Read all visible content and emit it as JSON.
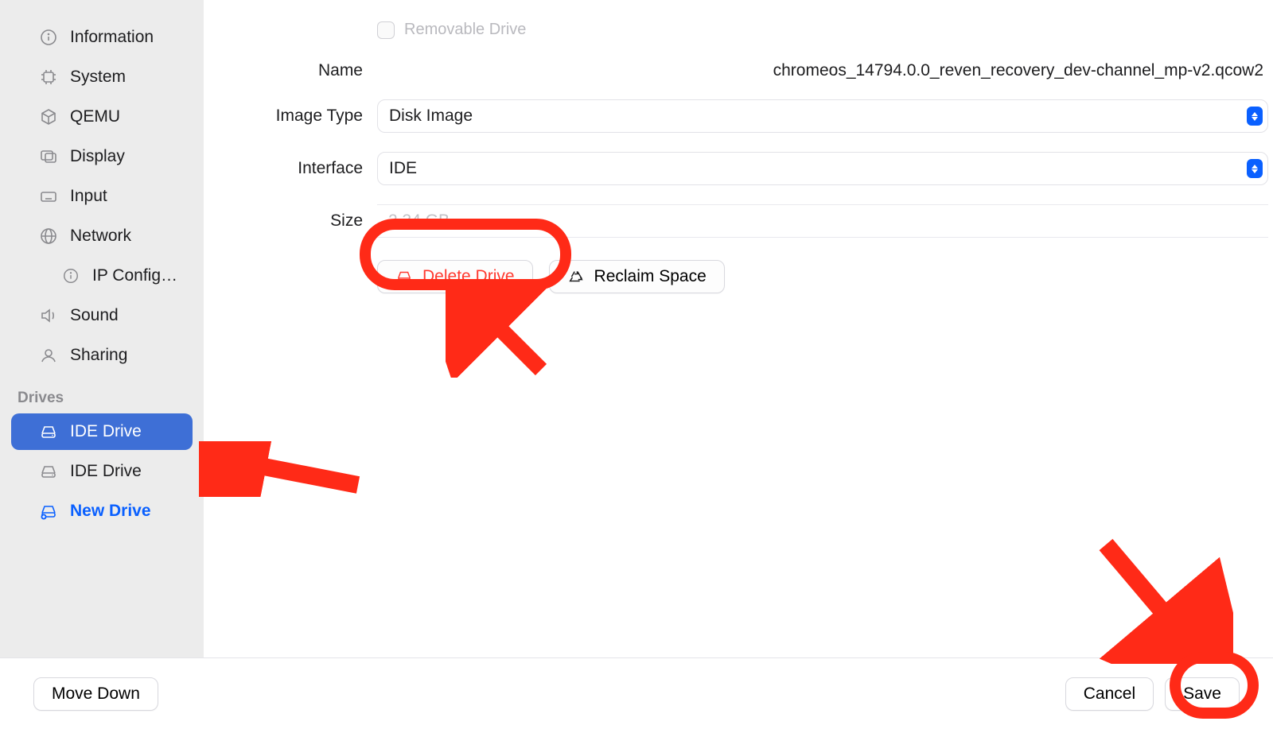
{
  "sidebar": {
    "items": [
      {
        "label": "Information"
      },
      {
        "label": "System"
      },
      {
        "label": "QEMU"
      },
      {
        "label": "Display"
      },
      {
        "label": "Input"
      },
      {
        "label": "Network"
      },
      {
        "label": "IP Config…"
      },
      {
        "label": "Sound"
      },
      {
        "label": "Sharing"
      }
    ],
    "drives_header": "Drives",
    "drives": [
      {
        "label": "IDE Drive"
      },
      {
        "label": "IDE Drive"
      },
      {
        "label": "New Drive"
      }
    ]
  },
  "form": {
    "removable_label": "Removable Drive",
    "name_label": "Name",
    "name_value": "chromeos_14794.0.0_reven_recovery_dev-channel_mp-v2.qcow2",
    "imagetype_label": "Image Type",
    "imagetype_value": "Disk Image",
    "interface_label": "Interface",
    "interface_value": "IDE",
    "size_label": "Size",
    "size_value": "2.34 GB",
    "delete_label": "Delete Drive",
    "reclaim_label": "Reclaim Space"
  },
  "footer": {
    "movedown": "Move Down",
    "cancel": "Cancel",
    "save": "Save"
  }
}
